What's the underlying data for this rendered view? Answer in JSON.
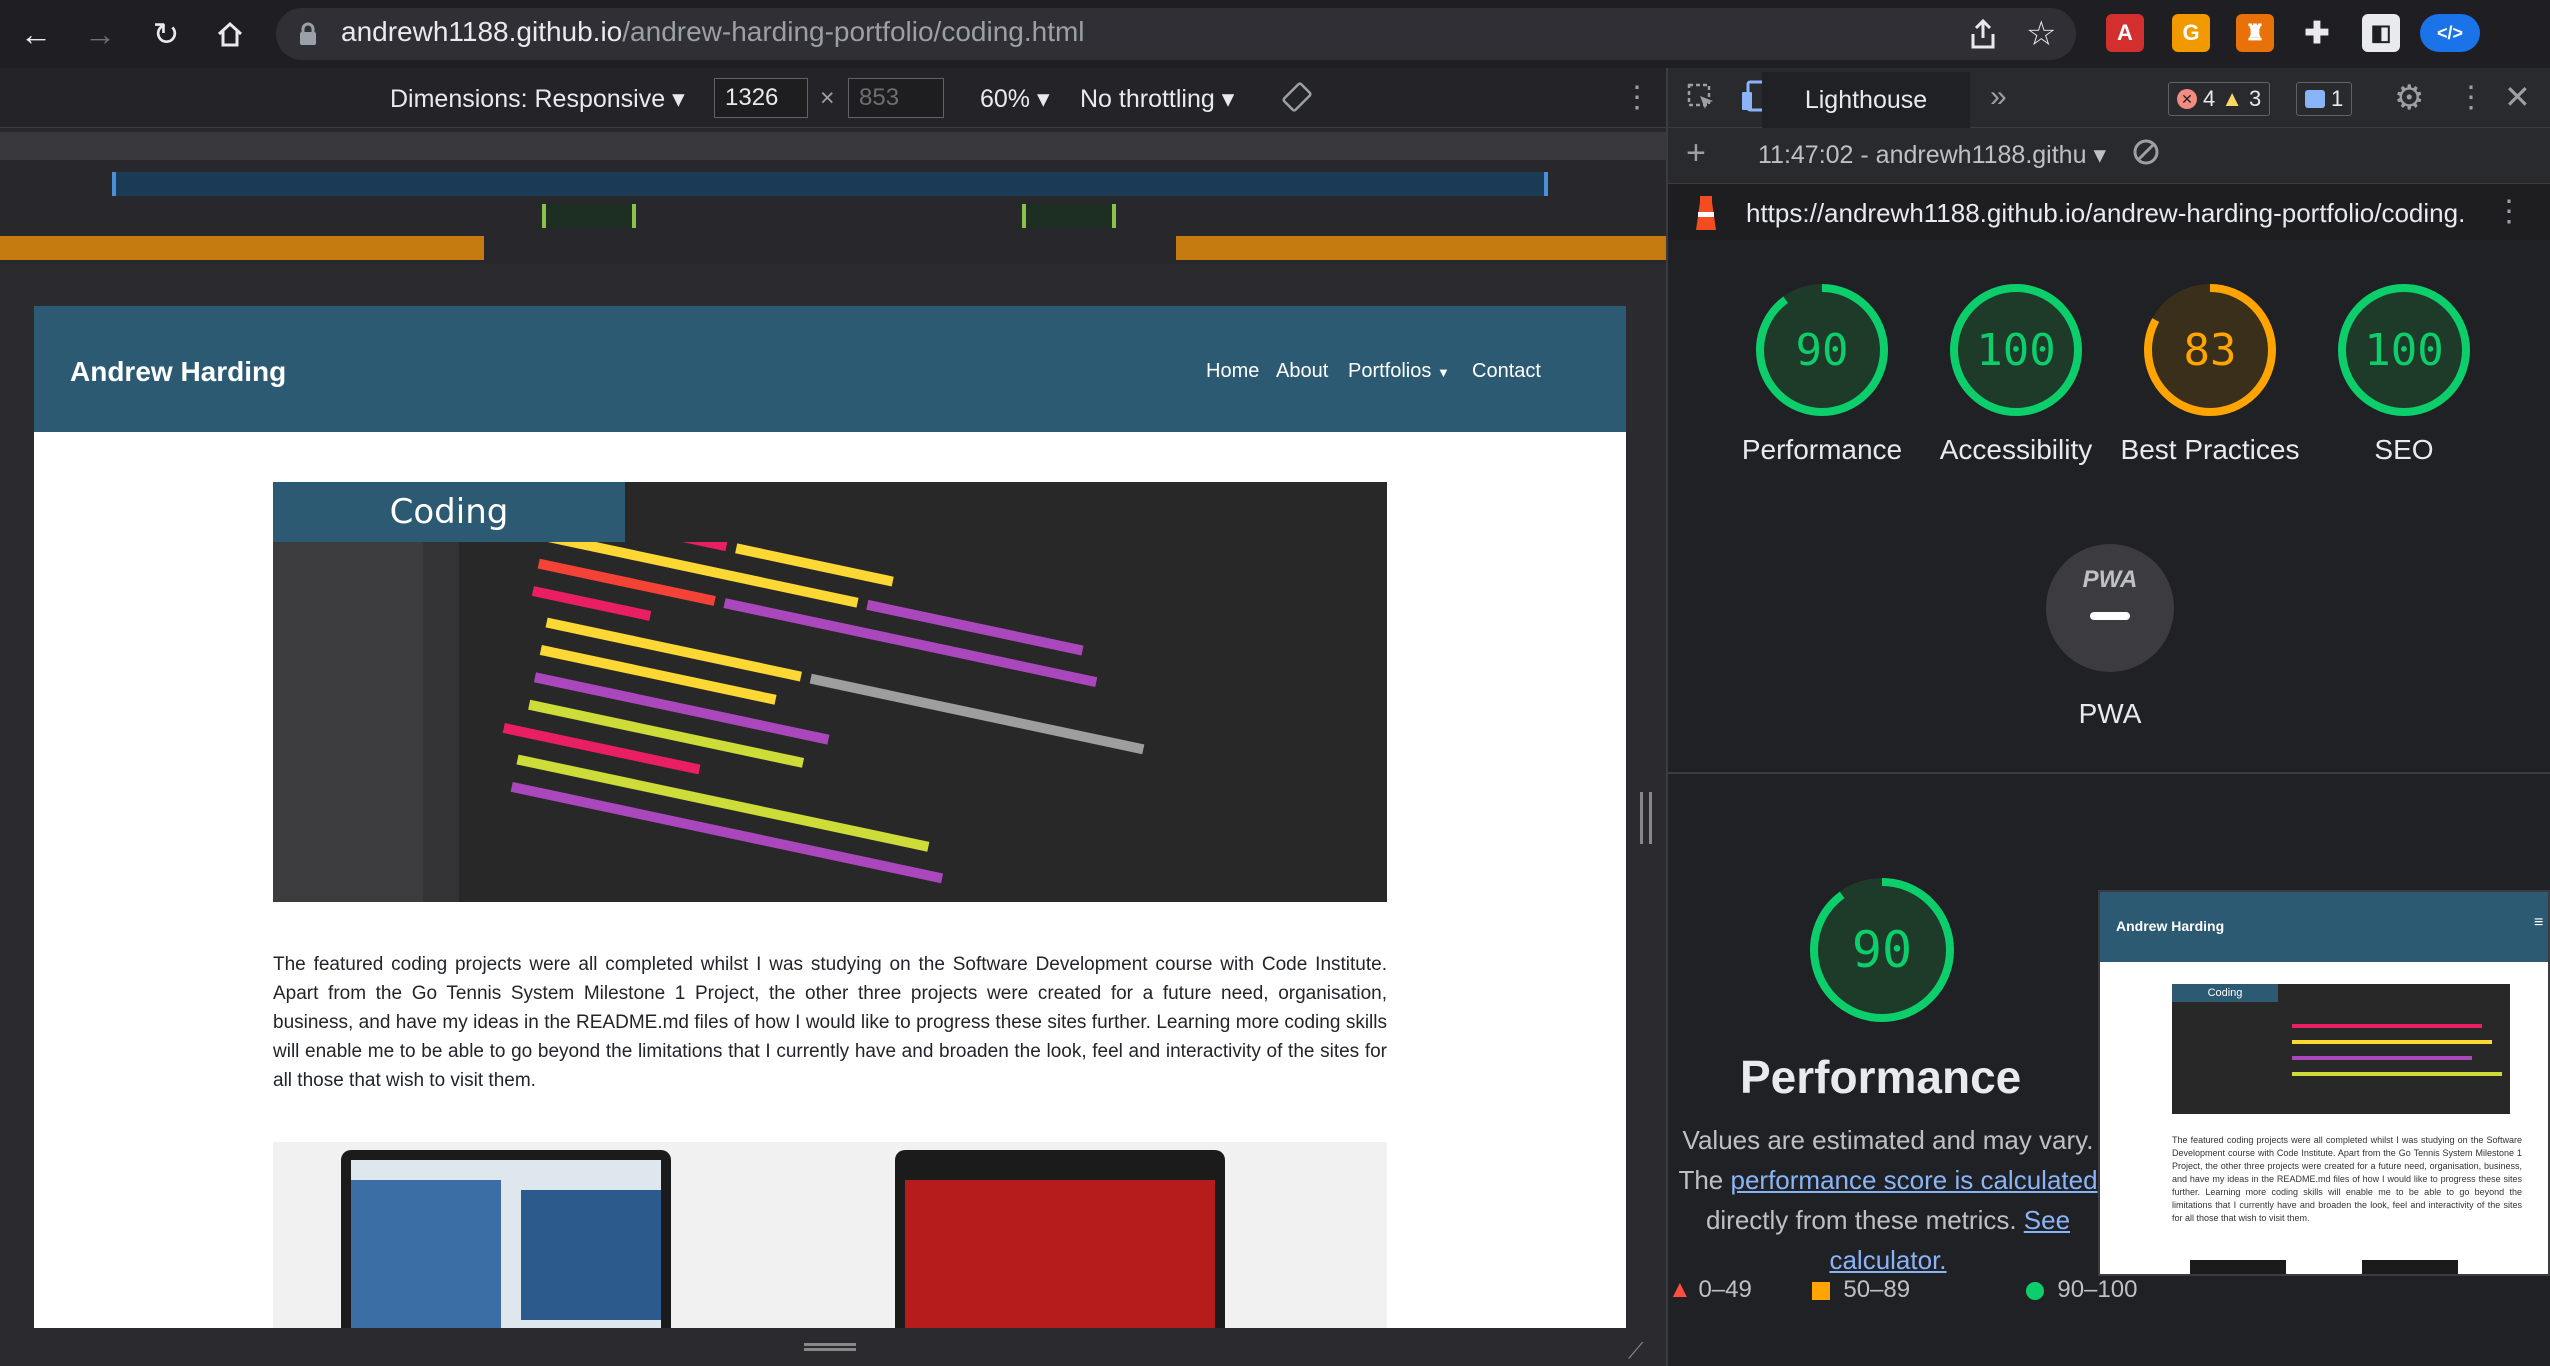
{
  "browser": {
    "url_host": "andrewh1188.github.io",
    "url_path": "/andrew-harding-portfolio/coding.html",
    "icons": [
      "back-icon",
      "forward-icon",
      "reload-icon",
      "home-icon",
      "lock-icon",
      "share-icon",
      "star-icon",
      "pdf-extension-icon",
      "g-extension-icon",
      "lighthouse-extension-icon",
      "puzzle-extension-icon",
      "profile-icon",
      "code-extension-icon"
    ]
  },
  "device_toolbar": {
    "dimensions_label": "Dimensions: Responsive",
    "width_value": "1326",
    "times": "×",
    "height_placeholder": "853",
    "zoom_label": "60%",
    "throttle_label": "No throttling"
  },
  "site": {
    "brand": "Andrew Harding",
    "nav": [
      "Home",
      "About",
      "Portfolios",
      "Contact"
    ],
    "hero_banner": "Coding",
    "intro": "The featured coding projects were all completed whilst I was studying on the Software Development course with Code Institute. Apart from the Go Tennis System Milestone 1 Project, the other three projects were created for a future need, organisation, business, and have my ideas in the README.md files of how I would like to progress these sites further. Learning more coding skills will enable me to be able to go beyond the limitations that I currently have and broaden the look, feel and interactivity of the sites for all those that wish to visit them."
  },
  "devtools": {
    "active_tab": "Lighthouse",
    "more_tabs": "»",
    "errors_count": "4",
    "warnings_count": "3",
    "messages_count": "1",
    "report_selector": "11:47:02 - andrewh1188.githu",
    "report_url": "https://andrewh1188.github.io/andrew-harding-portfolio/coding.…",
    "scores": [
      {
        "label": "Performance",
        "score": 90,
        "color": "#0cce6b"
      },
      {
        "label": "Accessibility",
        "score": 100,
        "color": "#0cce6b"
      },
      {
        "label": "Best Practices",
        "score": 83,
        "color": "#ffa400"
      },
      {
        "label": "SEO",
        "score": 100,
        "color": "#0cce6b"
      }
    ],
    "pwa_label": "PWA",
    "pwa_badge": "PWA",
    "detail": {
      "score": 90,
      "title": "Performance",
      "desc_pre": "Values are estimated and may vary. The ",
      "desc_link1": "performance score is calculated",
      "desc_mid": " directly from these metrics. ",
      "desc_link2": "See calculator."
    },
    "legend": [
      "0–49",
      "50–89",
      "90–100"
    ],
    "thumbnail": {
      "brand": "Andrew Harding",
      "banner": "Coding"
    }
  }
}
